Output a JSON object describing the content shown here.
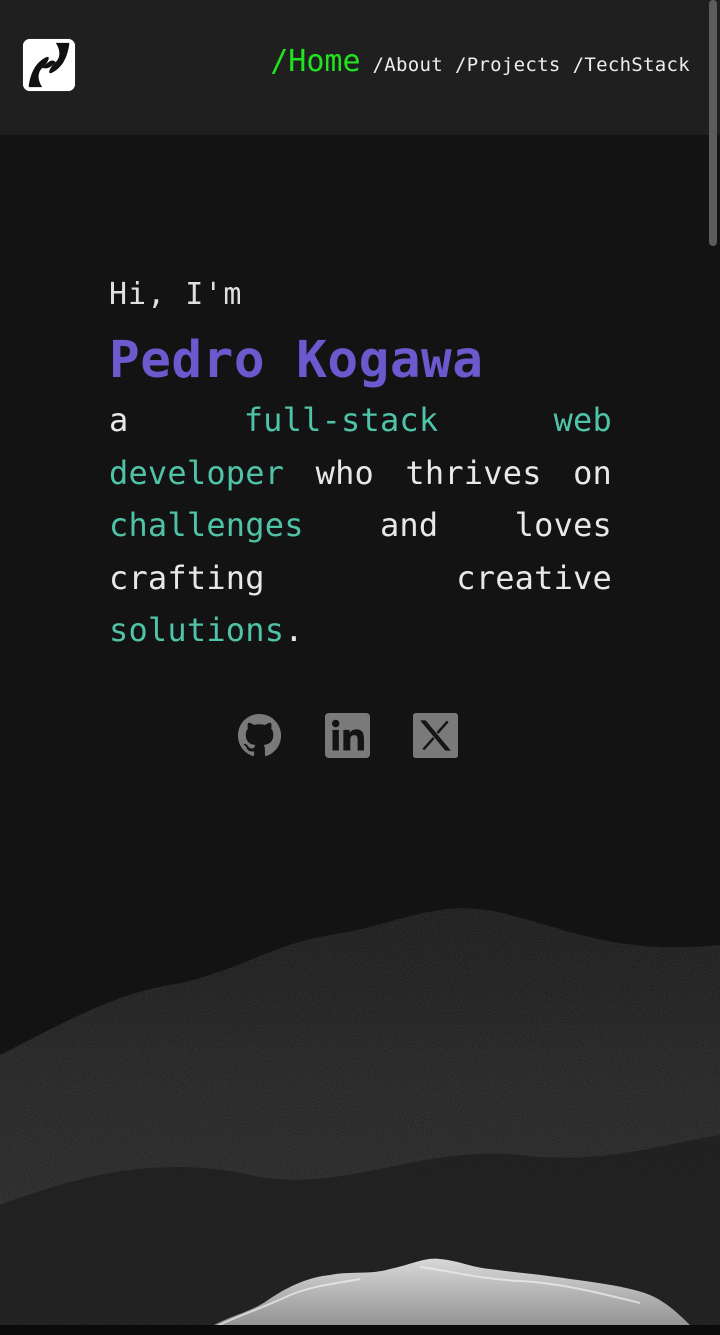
{
  "header": {
    "logo_icon": "stylized-n-logo-icon",
    "nav": [
      {
        "label": "/Home",
        "active": true
      },
      {
        "label": "/About",
        "active": false
      },
      {
        "label": "/Projects",
        "active": false
      },
      {
        "label": "/TechStack",
        "active": false
      }
    ]
  },
  "hero": {
    "greeting": "Hi, I'm",
    "name": "Pedro Kogawa",
    "tagline": {
      "part1": "a ",
      "accent1": "full-stack web developer",
      "part2": " who thrives on ",
      "accent2": "challenges",
      "part3": " and loves crafting creative ",
      "accent3": "solutions",
      "part4": "."
    }
  },
  "socials": [
    {
      "icon": "github-icon"
    },
    {
      "icon": "linkedin-icon"
    },
    {
      "icon": "x-twitter-icon"
    }
  ],
  "colors": {
    "background": "#131313",
    "header_bg": "#1f1f1f",
    "nav_active": "#1fe41f",
    "name": "#6a5acd",
    "accent": "#4fc3a8",
    "text": "#e8e8e8",
    "icon": "#7a7a7a"
  }
}
